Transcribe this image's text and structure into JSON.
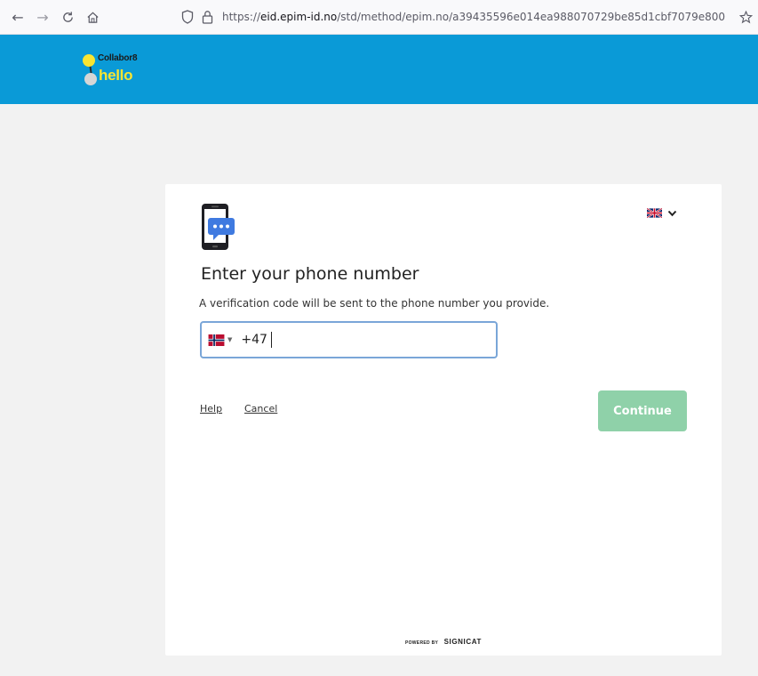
{
  "browser": {
    "url_prefix": "https://",
    "url_host": "eid.epim-id.no",
    "url_path": "/std/method/epim.no/a39435596e014ea988070729be85d1cbf7079e800",
    "icons": {
      "back": "arrow-left-icon",
      "forward": "arrow-right-icon",
      "reload": "reload-icon",
      "home": "home-icon",
      "shield": "shield-icon",
      "lock": "lock-icon",
      "bookmark": "star-icon"
    }
  },
  "header": {
    "brand_line1": "Collabor8",
    "brand_line2": "hello",
    "colors": {
      "background": "#0a9ad7",
      "accent": "#f9e531"
    }
  },
  "card": {
    "title": "Enter your phone number",
    "subtitle": "A verification code will be sent to the phone number you provide.",
    "language": {
      "selected_flag": "uk-flag-icon"
    },
    "phone": {
      "country_flag": "norway-flag-icon",
      "value": "+47"
    },
    "links": {
      "help": "Help",
      "cancel": "Cancel"
    },
    "continue_label": "Continue",
    "continue_color": "#8fd1a9",
    "footer": {
      "powered_by": "POWERED BY",
      "brand": "SIGNICAT"
    }
  }
}
